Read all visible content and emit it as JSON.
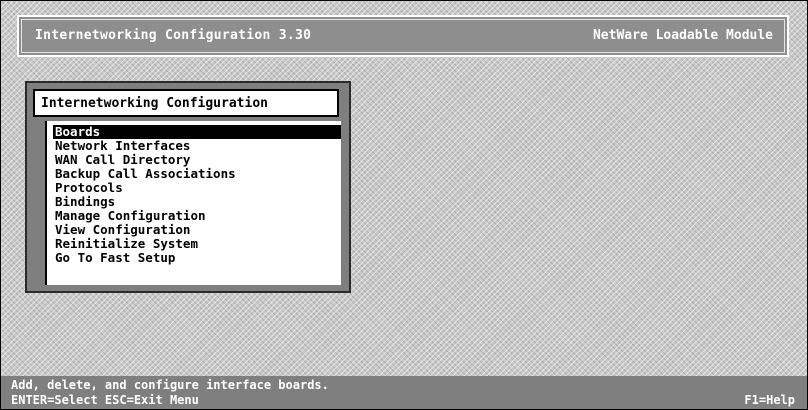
{
  "header": {
    "title": "Internetworking Configuration  3.30",
    "module": "NetWare Loadable Module"
  },
  "menu": {
    "title": "Internetworking Configuration",
    "items": [
      "Boards",
      "Network Interfaces",
      "WAN Call Directory",
      "Backup Call Associations",
      "Protocols",
      "Bindings",
      "Manage Configuration",
      "View Configuration",
      "Reinitialize System",
      "Go To Fast Setup"
    ],
    "selected_index": 0
  },
  "footer": {
    "description": "Add, delete, and configure interface boards.",
    "keys": "ENTER=Select  ESC=Exit Menu",
    "help": "F1=Help"
  },
  "colors": {
    "header_bg": "#8e8e8e",
    "selection_bg": "#000000",
    "window_bg": "#ffffff",
    "footer_bg": "#7f7f7f"
  }
}
